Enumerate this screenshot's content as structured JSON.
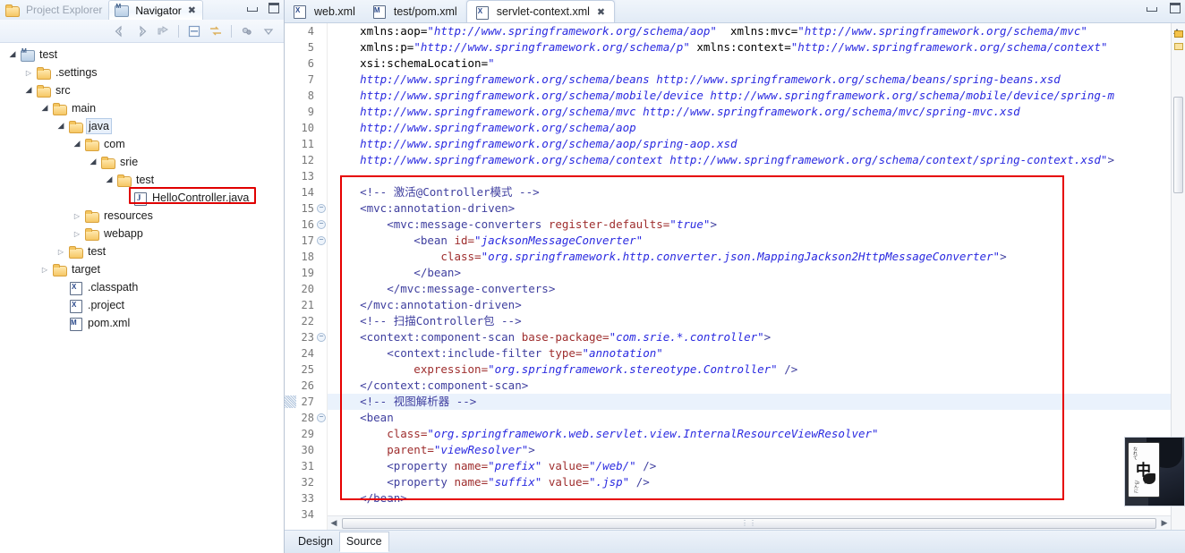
{
  "left_view": {
    "tabs": [
      {
        "label": "Project Explorer",
        "icon": "project-explorer-icon",
        "active": false
      },
      {
        "label": "Navigator",
        "icon": "navigator-icon",
        "active": true,
        "close": "✖"
      }
    ],
    "window_controls": {
      "minimize": "minimize-icon",
      "maximize": "maximize-icon"
    },
    "toolbar_icons": [
      "back-arrow-icon",
      "forward-arrow-icon",
      "up-arrow-icon",
      "collapse-all-icon",
      "link-with-editor-icon",
      "filter-icon",
      "view-menu-icon"
    ],
    "tree": [
      {
        "label": "test",
        "indent": 0,
        "twist": "open",
        "icon": "project-icon",
        "selected": false,
        "highlight": false
      },
      {
        "label": ".settings",
        "indent": 1,
        "twist": "closed",
        "icon": "folder-icon",
        "selected": false,
        "highlight": false
      },
      {
        "label": "src",
        "indent": 1,
        "twist": "open",
        "icon": "folder-icon",
        "selected": false,
        "highlight": false
      },
      {
        "label": "main",
        "indent": 2,
        "twist": "open",
        "icon": "folder-icon",
        "selected": false,
        "highlight": false
      },
      {
        "label": "java",
        "indent": 3,
        "twist": "open",
        "icon": "folder-icon",
        "selected": true,
        "highlight": false
      },
      {
        "label": "com",
        "indent": 4,
        "twist": "open",
        "icon": "folder-icon",
        "selected": false,
        "highlight": false
      },
      {
        "label": "srie",
        "indent": 5,
        "twist": "open",
        "icon": "folder-icon",
        "selected": false,
        "highlight": false
      },
      {
        "label": "test",
        "indent": 6,
        "twist": "open",
        "icon": "folder-icon",
        "selected": false,
        "highlight": false
      },
      {
        "label": "HelloController.java",
        "indent": 7,
        "twist": "none",
        "icon": "java-file-icon",
        "selected": false,
        "highlight": true
      },
      {
        "label": "resources",
        "indent": 4,
        "twist": "closed",
        "icon": "folder-icon",
        "selected": false,
        "highlight": false
      },
      {
        "label": "webapp",
        "indent": 4,
        "twist": "closed",
        "icon": "folder-icon",
        "selected": false,
        "highlight": false
      },
      {
        "label": "test",
        "indent": 3,
        "twist": "closed",
        "icon": "folder-icon",
        "selected": false,
        "highlight": false
      },
      {
        "label": "target",
        "indent": 2,
        "twist": "closed",
        "icon": "folder-icon",
        "selected": false,
        "highlight": false
      },
      {
        "label": ".classpath",
        "indent": 3,
        "twist": "none",
        "icon": "xml-file-icon",
        "selected": false,
        "highlight": false
      },
      {
        "label": ".project",
        "indent": 3,
        "twist": "none",
        "icon": "xml-file-icon",
        "selected": false,
        "highlight": false
      },
      {
        "label": "pom.xml",
        "indent": 3,
        "twist": "none",
        "icon": "pom-file-icon",
        "selected": false,
        "highlight": false
      }
    ]
  },
  "editor": {
    "tabs": [
      {
        "label": "web.xml",
        "icon": "xml-file-icon",
        "active": false
      },
      {
        "label": "test/pom.xml",
        "icon": "pom-file-icon",
        "active": false
      },
      {
        "label": "servlet-context.xml",
        "icon": "xml-file-icon",
        "active": true,
        "close": "✖"
      }
    ],
    "window_controls": {
      "minimize": "minimize-icon",
      "maximize": "maximize-icon"
    },
    "bottom_tabs": [
      {
        "label": "Design",
        "active": false
      },
      {
        "label": "Source",
        "active": true
      }
    ],
    "scroll": {
      "h_grip": "⋮⋮",
      "left_arrow": "◀",
      "right_arrow": "▶"
    },
    "current_line": 27,
    "highlight_box_color": "#e60000",
    "lines": [
      {
        "n": 4,
        "fold": false,
        "tokens": [
          {
            "t": "plain",
            "s": "    xmlns:aop="
          },
          {
            "t": "url",
            "s": "\"http://www.springframework.org/schema/aop\""
          },
          {
            "t": "plain",
            "s": "  xmlns:mvc="
          },
          {
            "t": "url",
            "s": "\"http://www.springframework.org/schema/mvc\""
          }
        ]
      },
      {
        "n": 5,
        "fold": false,
        "tokens": [
          {
            "t": "plain",
            "s": "    xmlns:p="
          },
          {
            "t": "url",
            "s": "\"http://www.springframework.org/schema/p\""
          },
          {
            "t": "plain",
            "s": " xmlns:context="
          },
          {
            "t": "url",
            "s": "\"http://www.springframework.org/schema/context\""
          }
        ]
      },
      {
        "n": 6,
        "fold": false,
        "tokens": [
          {
            "t": "plain",
            "s": "    xsi:schemaLocation="
          },
          {
            "t": "url",
            "s": "\""
          }
        ]
      },
      {
        "n": 7,
        "fold": false,
        "tokens": [
          {
            "t": "url",
            "s": "    http://www.springframework.org/schema/beans http://www.springframework.org/schema/beans/spring-beans.xsd"
          }
        ]
      },
      {
        "n": 8,
        "fold": false,
        "tokens": [
          {
            "t": "url",
            "s": "    http://www.springframework.org/schema/mobile/device http://www.springframework.org/schema/mobile/device/spring-m"
          }
        ]
      },
      {
        "n": 9,
        "fold": false,
        "tokens": [
          {
            "t": "url",
            "s": "    http://www.springframework.org/schema/mvc http://www.springframework.org/schema/mvc/spring-mvc.xsd"
          }
        ]
      },
      {
        "n": 10,
        "fold": false,
        "tokens": [
          {
            "t": "url",
            "s": "    http://www.springframework.org/schema/aop"
          }
        ]
      },
      {
        "n": 11,
        "fold": false,
        "tokens": [
          {
            "t": "url",
            "s": "    http://www.springframework.org/schema/aop/spring-aop.xsd"
          }
        ]
      },
      {
        "n": 12,
        "fold": false,
        "tokens": [
          {
            "t": "url",
            "s": "    http://www.springframework.org/schema/context http://www.springframework.org/schema/context/spring-context.xsd\""
          },
          {
            "t": "tag",
            "s": ">"
          }
        ]
      },
      {
        "n": 13,
        "fold": false,
        "tokens": [
          {
            "t": "plain",
            "s": ""
          }
        ]
      },
      {
        "n": 14,
        "fold": false,
        "tokens": [
          {
            "t": "cmt",
            "s": "    <!-- 激活@Controller模式 -->"
          }
        ]
      },
      {
        "n": 15,
        "fold": true,
        "tokens": [
          {
            "t": "tag",
            "s": "    <mvc:annotation-driven>"
          }
        ]
      },
      {
        "n": 16,
        "fold": true,
        "tokens": [
          {
            "t": "tag",
            "s": "        <mvc:message-converters "
          },
          {
            "t": "attr",
            "s": "register-defaults="
          },
          {
            "t": "val",
            "s": "\"true\""
          },
          {
            "t": "tag",
            "s": ">"
          }
        ]
      },
      {
        "n": 17,
        "fold": true,
        "tokens": [
          {
            "t": "tag",
            "s": "            <bean "
          },
          {
            "t": "attr",
            "s": "id="
          },
          {
            "t": "val",
            "s": "\"jacksonMessageConverter\""
          }
        ]
      },
      {
        "n": 18,
        "fold": false,
        "tokens": [
          {
            "t": "attr",
            "s": "                class="
          },
          {
            "t": "val",
            "s": "\"org.springframework.http.converter.json.MappingJackson2HttpMessageConverter\""
          },
          {
            "t": "tag",
            "s": ">"
          }
        ]
      },
      {
        "n": 19,
        "fold": false,
        "tokens": [
          {
            "t": "tag",
            "s": "            </bean>"
          }
        ]
      },
      {
        "n": 20,
        "fold": false,
        "tokens": [
          {
            "t": "tag",
            "s": "        </mvc:message-converters>"
          }
        ]
      },
      {
        "n": 21,
        "fold": false,
        "tokens": [
          {
            "t": "tag",
            "s": "    </mvc:annotation-driven>"
          }
        ]
      },
      {
        "n": 22,
        "fold": false,
        "tokens": [
          {
            "t": "cmt",
            "s": "    <!-- 扫描Controller包 -->"
          }
        ]
      },
      {
        "n": 23,
        "fold": true,
        "tokens": [
          {
            "t": "tag",
            "s": "    <context:component-scan "
          },
          {
            "t": "attr",
            "s": "base-package="
          },
          {
            "t": "val",
            "s": "\"com.srie.*.controller\""
          },
          {
            "t": "tag",
            "s": ">"
          }
        ]
      },
      {
        "n": 24,
        "fold": false,
        "tokens": [
          {
            "t": "tag",
            "s": "        <context:include-filter "
          },
          {
            "t": "attr",
            "s": "type="
          },
          {
            "t": "val",
            "s": "\"annotation\""
          }
        ]
      },
      {
        "n": 25,
        "fold": false,
        "tokens": [
          {
            "t": "attr",
            "s": "            expression="
          },
          {
            "t": "val",
            "s": "\"org.springframework.stereotype.Controller\""
          },
          {
            "t": "tag",
            "s": " />"
          }
        ]
      },
      {
        "n": 26,
        "fold": false,
        "tokens": [
          {
            "t": "tag",
            "s": "    </context:component-scan>"
          }
        ]
      },
      {
        "n": 27,
        "fold": false,
        "current": true,
        "tokens": [
          {
            "t": "cmt",
            "s": "    <!-- 视图解析器 -->"
          }
        ]
      },
      {
        "n": 28,
        "fold": true,
        "tokens": [
          {
            "t": "tag",
            "s": "    <bean"
          }
        ]
      },
      {
        "n": 29,
        "fold": false,
        "tokens": [
          {
            "t": "attr",
            "s": "        class="
          },
          {
            "t": "val",
            "s": "\"org.springframework.web.servlet.view.InternalResourceViewResolver\""
          }
        ]
      },
      {
        "n": 30,
        "fold": false,
        "tokens": [
          {
            "t": "attr",
            "s": "        parent="
          },
          {
            "t": "val",
            "s": "\"viewResolver\""
          },
          {
            "t": "tag",
            "s": ">"
          }
        ]
      },
      {
        "n": 31,
        "fold": false,
        "tokens": [
          {
            "t": "tag",
            "s": "        <property "
          },
          {
            "t": "attr",
            "s": "name="
          },
          {
            "t": "val",
            "s": "\"prefix\""
          },
          {
            "t": "attr",
            "s": " value="
          },
          {
            "t": "val",
            "s": "\"/web/\""
          },
          {
            "t": "tag",
            "s": " />"
          }
        ]
      },
      {
        "n": 32,
        "fold": false,
        "tokens": [
          {
            "t": "tag",
            "s": "        <property "
          },
          {
            "t": "attr",
            "s": "name="
          },
          {
            "t": "val",
            "s": "\"suffix\""
          },
          {
            "t": "attr",
            "s": " value="
          },
          {
            "t": "val",
            "s": "\".jsp\""
          },
          {
            "t": "tag",
            "s": " />"
          }
        ]
      },
      {
        "n": 33,
        "fold": false,
        "tokens": [
          {
            "t": "tag",
            "s": "    </bean>"
          }
        ]
      },
      {
        "n": 34,
        "fold": false,
        "tokens": [
          {
            "t": "plain",
            "s": ""
          }
        ]
      }
    ]
  },
  "watermark": {
    "bubble_char": "中",
    "dots": "。,",
    "side_text": "なれて",
    "side_text2": "こんに"
  }
}
